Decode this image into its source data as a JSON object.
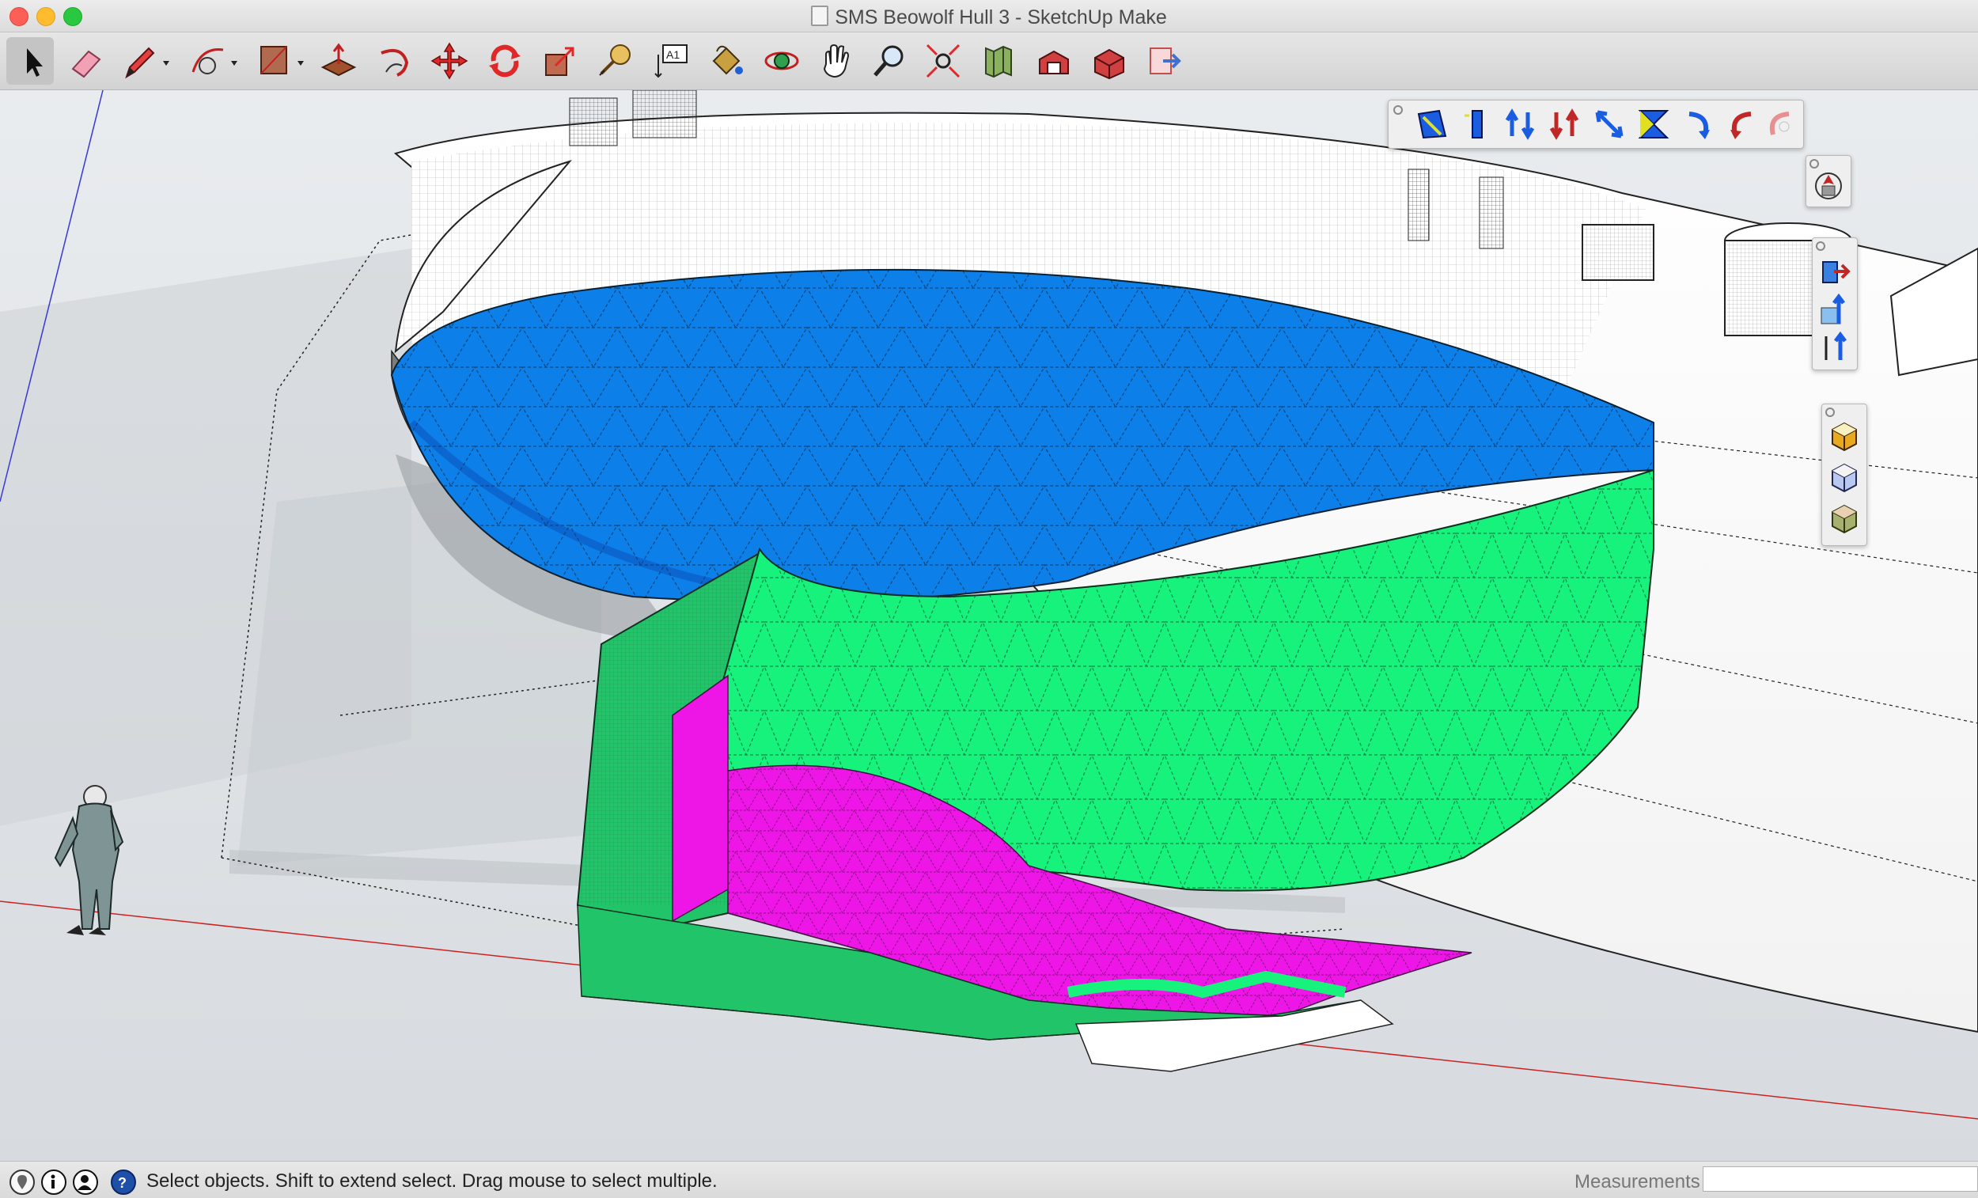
{
  "window": {
    "title": "SMS Beowolf Hull 3 - SketchUp Make",
    "traffic_lights": {
      "close": "#fd5f57",
      "minimize": "#febc2e",
      "zoom": "#29c840"
    }
  },
  "toolbar": {
    "tools": [
      "select",
      "eraser",
      "pencil-line",
      "arc",
      "rectangle",
      "push-pull",
      "follow-me",
      "move",
      "rotate",
      "scale",
      "tape-measure",
      "text",
      "paint-bucket",
      "orbit",
      "pan",
      "zoom",
      "zoom-extents",
      "map",
      "component-1",
      "component-2",
      "export"
    ]
  },
  "model": {
    "colors": {
      "blue": "#0d7fe8",
      "green": "#16f27c",
      "dark_green": "#22c46a",
      "magenta": "#ee16e6",
      "hull": "#ffffff",
      "red_axis": "#cc2222",
      "blue_axis": "#3a3ad0"
    }
  },
  "status": {
    "hint": "Select objects. Shift to extend select. Drag mouse to select multiple.",
    "measurements_label": "Measurements",
    "measurements_value": ""
  }
}
